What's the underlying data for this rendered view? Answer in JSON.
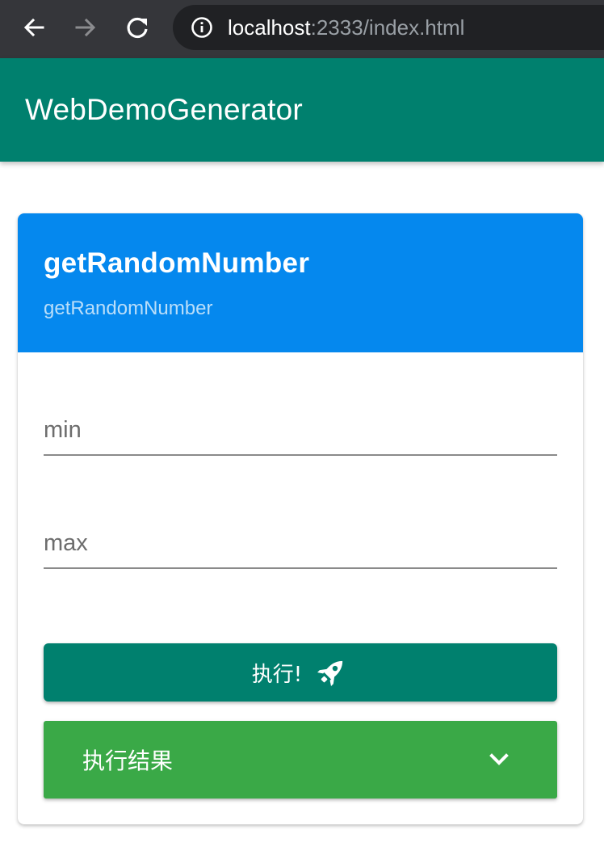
{
  "browser": {
    "url_host": "localhost",
    "url_path": ":2333/index.html"
  },
  "app": {
    "title": "WebDemoGenerator"
  },
  "card": {
    "title": "getRandomNumber",
    "subtitle": "getRandomNumber",
    "fields": {
      "min": {
        "placeholder": "min",
        "value": ""
      },
      "max": {
        "placeholder": "max",
        "value": ""
      }
    },
    "run_button_label": "执行!",
    "result_label": "执行结果"
  },
  "colors": {
    "app_bar": "#00806e",
    "card_header": "#0588ee",
    "run_button": "#00806e",
    "result_panel": "#3aa947"
  },
  "icons": {
    "back": "arrow-left-icon",
    "forward": "arrow-right-icon",
    "reload": "reload-icon",
    "info": "info-icon",
    "run": "rocket-icon",
    "expand": "chevron-down-icon"
  }
}
